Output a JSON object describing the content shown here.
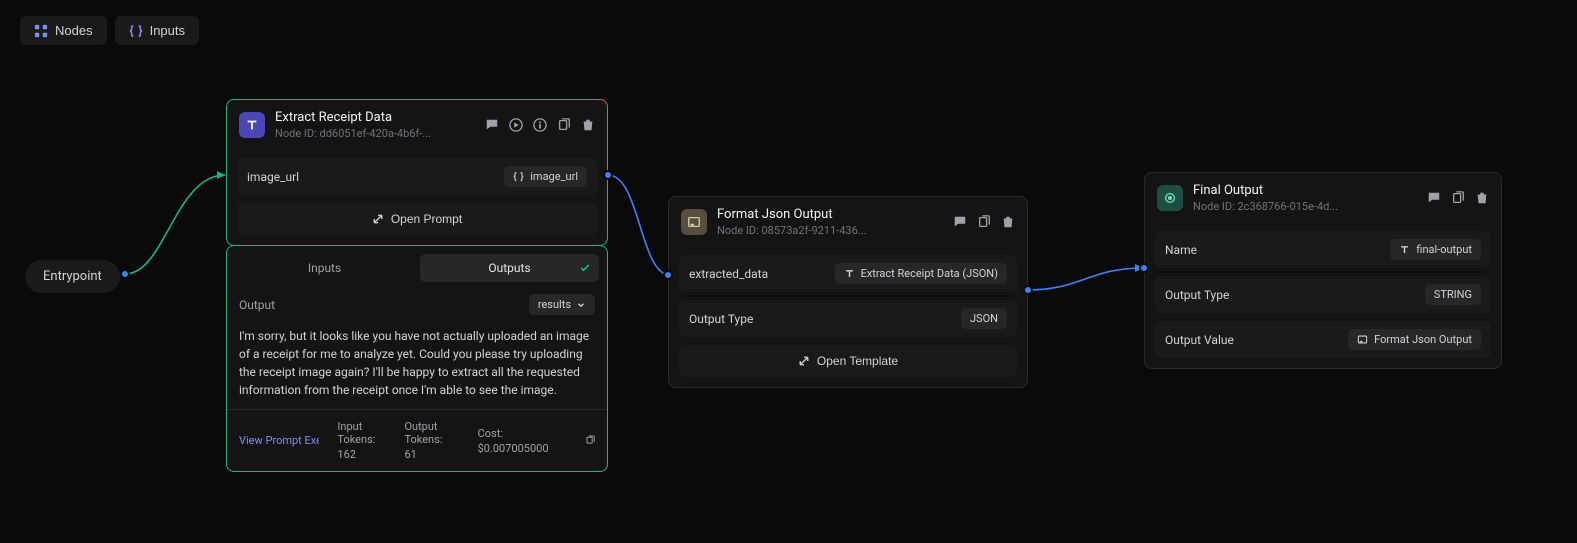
{
  "toolbar": {
    "nodes_label": "Nodes",
    "inputs_label": "Inputs"
  },
  "entrypoint": {
    "label": "Entrypoint"
  },
  "node_extract": {
    "title": "Extract Receipt Data",
    "node_id_label": "Node ID:",
    "node_id": "dd6051ef-420a-4b6f-...",
    "param_label": "image_url",
    "param_chip": "image_url",
    "open_prompt_label": "Open Prompt"
  },
  "panel_extract": {
    "tab_inputs": "Inputs",
    "tab_outputs": "Outputs",
    "output_label": "Output",
    "selector": "results",
    "result_text": "I'm sorry, but it looks like you have not actually uploaded an image of a receipt for me to analyze yet. Could you please try uploading the receipt image again? I'll be happy to extract all the requested information from the receipt once I'm able to see the image.",
    "view_link": "View Prompt Executio",
    "input_tokens_label": "Input Tokens:",
    "input_tokens_value": "162",
    "output_tokens_label": "Output Tokens:",
    "output_tokens_value": "61",
    "cost_label": "Cost:",
    "cost_value": "$0.007005000"
  },
  "node_format": {
    "title": "Format Json Output",
    "node_id_label": "Node ID:",
    "node_id": "08573a2f-9211-436...",
    "param_label": "extracted_data",
    "param_chip": "Extract Receipt Data (JSON)",
    "output_type_label": "Output Type",
    "output_type_value": "JSON",
    "open_template_label": "Open Template"
  },
  "node_final": {
    "title": "Final Output",
    "node_id_label": "Node ID:",
    "node_id": "2c368766-015e-4d...",
    "name_label": "Name",
    "name_value": "final-output",
    "output_type_label": "Output Type",
    "output_type_value": "STRING",
    "output_value_label": "Output Value",
    "output_value_chip": "Format Json Output"
  }
}
